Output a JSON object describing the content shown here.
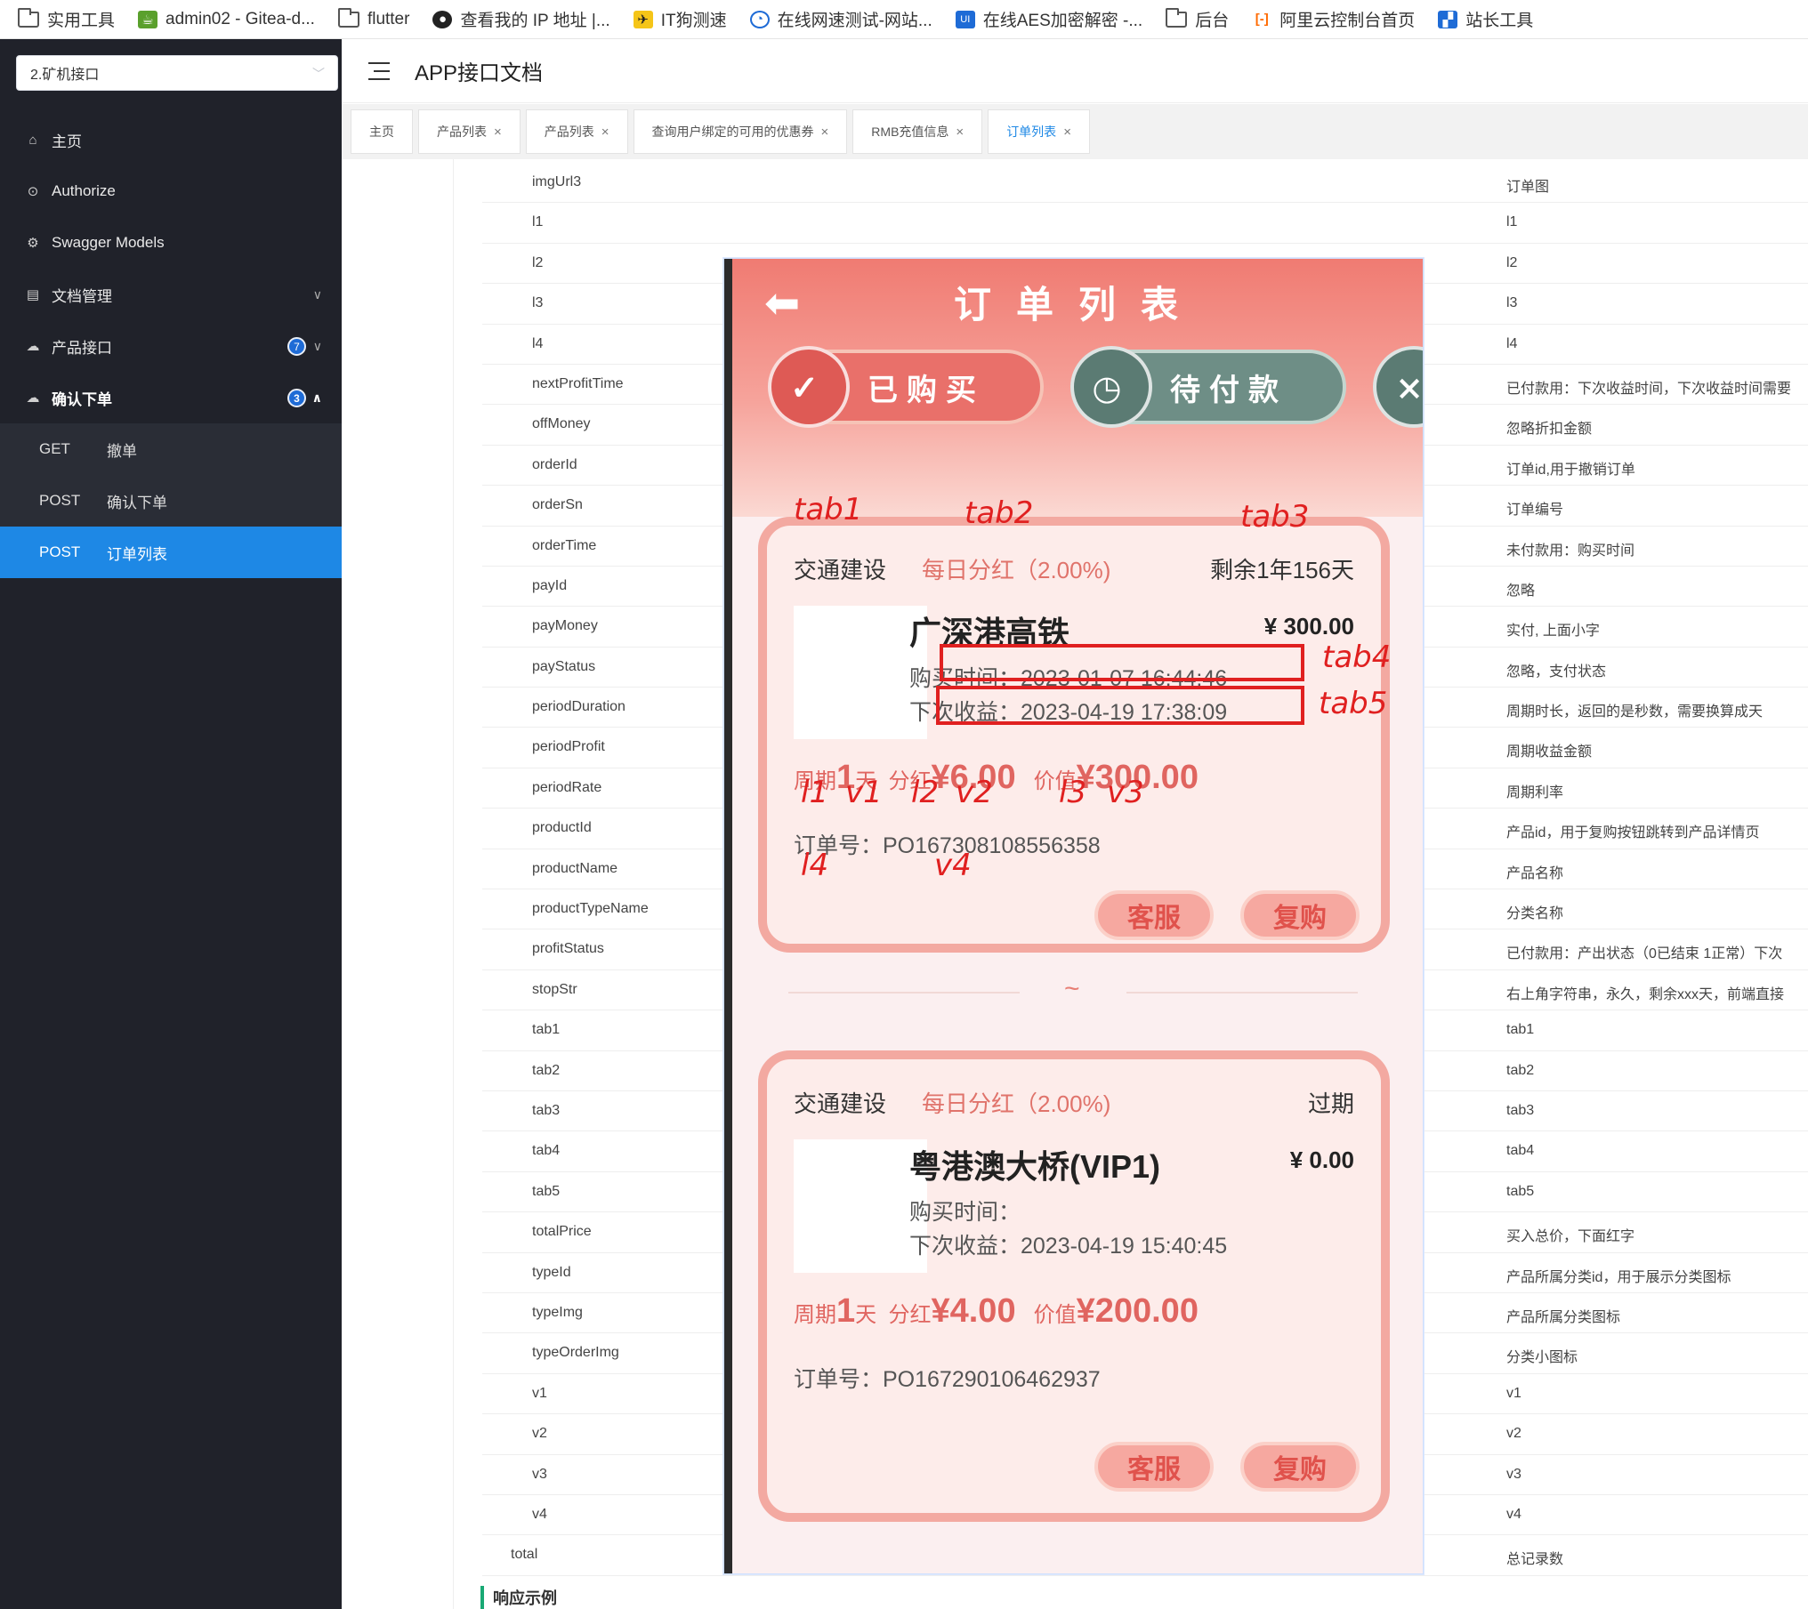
{
  "bookmarks": [
    {
      "label": "实用工具",
      "icon": "folder-icon"
    },
    {
      "label": "admin02 - Gitea-d...",
      "icon": "gitea-icon"
    },
    {
      "label": "flutter",
      "icon": "folder-icon"
    },
    {
      "label": "查看我的 IP 地址 |...",
      "icon": "octocat-icon"
    },
    {
      "label": "IT狗测速",
      "icon": "rocket-icon"
    },
    {
      "label": "在线网速测试-网站...",
      "icon": "speedtest-icon"
    },
    {
      "label": "在线AES加密解密 -...",
      "icon": "aes-icon"
    },
    {
      "label": "后台",
      "icon": "folder-icon"
    },
    {
      "label": "阿里云控制台首页",
      "icon": "aliyun-icon"
    },
    {
      "label": "站长工具",
      "icon": "chinaz-icon"
    }
  ],
  "sidebar": {
    "select_value": "2.矿机接口",
    "items": [
      {
        "label": "主页",
        "icon": "home-icon"
      },
      {
        "label": "Authorize",
        "icon": "lock-icon"
      },
      {
        "label": "Swagger Models",
        "icon": "gear-icon"
      },
      {
        "label": "文档管理",
        "icon": "doc-icon"
      },
      {
        "label": "产品接口",
        "icon": "cloud-icon",
        "badge": "7"
      },
      {
        "label": "确认下单",
        "icon": "cloud-icon",
        "badge": "3"
      }
    ],
    "sub_items": [
      {
        "method": "GET",
        "label": "撤单"
      },
      {
        "method": "POST",
        "label": "确认下单"
      },
      {
        "method": "POST",
        "label": "订单列表"
      }
    ]
  },
  "header": {
    "title": "APP接口文档"
  },
  "tabs": [
    {
      "label": "主页"
    },
    {
      "label": "产品列表"
    },
    {
      "label": "产品列表"
    },
    {
      "label": "查询用户绑定的可用的优惠券"
    },
    {
      "label": "RMB充值信息"
    },
    {
      "label": "订单列表"
    }
  ],
  "table_rows": [
    {
      "k": "imgUrl3",
      "d": "订单图"
    },
    {
      "k": "l1",
      "d": "l1"
    },
    {
      "k": "l2",
      "d": "l2"
    },
    {
      "k": "l3",
      "d": "l3"
    },
    {
      "k": "l4",
      "d": "l4"
    },
    {
      "k": "nextProfitTime",
      "d": "已付款用：下次收益时间，下次收益时间需要"
    },
    {
      "k": "offMoney",
      "d": "忽略折扣金额"
    },
    {
      "k": "orderId",
      "d": "订单id,用于撤销订单"
    },
    {
      "k": "orderSn",
      "d": "订单编号"
    },
    {
      "k": "orderTime",
      "d": "未付款用：购买时间"
    },
    {
      "k": "payId",
      "d": "忽略"
    },
    {
      "k": "payMoney",
      "d": "实付, 上面小字"
    },
    {
      "k": "payStatus",
      "d": "忽略，支付状态"
    },
    {
      "k": "periodDuration",
      "d": "周期时长，返回的是秒数，需要换算成天"
    },
    {
      "k": "periodProfit",
      "d": "周期收益金额"
    },
    {
      "k": "periodRate",
      "d": "周期利率"
    },
    {
      "k": "productId",
      "d": "产品id，用于复购按钮跳转到产品详情页"
    },
    {
      "k": "productName",
      "d": "产品名称"
    },
    {
      "k": "productTypeName",
      "d": "分类名称"
    },
    {
      "k": "profitStatus",
      "d": "已付款用：产出状态（0已结束 1正常）下次"
    },
    {
      "k": "stopStr",
      "d": "右上角字符串，永久，剩余xxx天，前端直接"
    },
    {
      "k": "tab1",
      "d": "tab1"
    },
    {
      "k": "tab2",
      "d": "tab2"
    },
    {
      "k": "tab3",
      "d": "tab3"
    },
    {
      "k": "tab4",
      "d": "tab4"
    },
    {
      "k": "tab5",
      "d": "tab5"
    },
    {
      "k": "totalPrice",
      "d": "买入总价，下面红字"
    },
    {
      "k": "typeId",
      "d": "产品所属分类id，用于展示分类图标"
    },
    {
      "k": "typeImg",
      "d": "产品所属分类图标"
    },
    {
      "k": "typeOrderImg",
      "d": "分类小图标"
    },
    {
      "k": "v1",
      "d": "v1"
    },
    {
      "k": "v2",
      "d": "v2"
    },
    {
      "k": "v3",
      "d": "v3"
    },
    {
      "k": "v4",
      "d": "v4"
    },
    {
      "k": "total",
      "d": "总记录数"
    }
  ],
  "response_heading": "响应示例",
  "phone": {
    "title": "订单列表",
    "tab_bought": "已购买",
    "tab_unpaid": "待付款",
    "cards": [
      {
        "category": "交通建设",
        "rate": "每日分红（2.00%)",
        "remain": "剩余1年156天",
        "name": "广深港高铁",
        "price": "¥ 300.00",
        "buy_time": "购买时间：2023-01-07 16:44:46",
        "next_profit": "下次收益：2023-04-19 17:38:09",
        "period_label": "周期",
        "period_value": "1",
        "period_unit": "天",
        "profit_label": "分红",
        "profit_value": "¥6.00",
        "worth_label": "价值",
        "worth_value": "¥300.00",
        "order_no": "订单号：PO167308108556358",
        "btn_service": "客服",
        "btn_rebuy": "复购"
      },
      {
        "category": "交通建设",
        "rate": "每日分红（2.00%)",
        "remain": "过期",
        "name": "粤港澳大桥(VIP1)",
        "price": "¥ 0.00",
        "buy_time": "购买时间：",
        "next_profit": "下次收益：2023-04-19 15:40:45",
        "period_label": "周期",
        "period_value": "1",
        "period_unit": "天",
        "profit_label": "分红",
        "profit_value": "¥4.00",
        "worth_label": "价值",
        "worth_value": "¥200.00",
        "order_no": "订单号：PO167290106462937",
        "btn_service": "客服",
        "btn_rebuy": "复购"
      }
    ],
    "separator": "~",
    "annotations": {
      "tab1": "tab1",
      "tab2": "tab2",
      "tab3": "tab3",
      "tab4": "tab4",
      "tab5": "tab5",
      "l1": "l1",
      "v1": "v1",
      "l2": "l2",
      "v2": "v2",
      "l3": "l3",
      "v3": "v3",
      "l4": "l4",
      "v4": "v4"
    }
  },
  "colors": {
    "sidebar_bg": "#20222a",
    "active_blue": "#1e88e5",
    "annotation_red": "#e02020",
    "card_red": "#e06560"
  }
}
